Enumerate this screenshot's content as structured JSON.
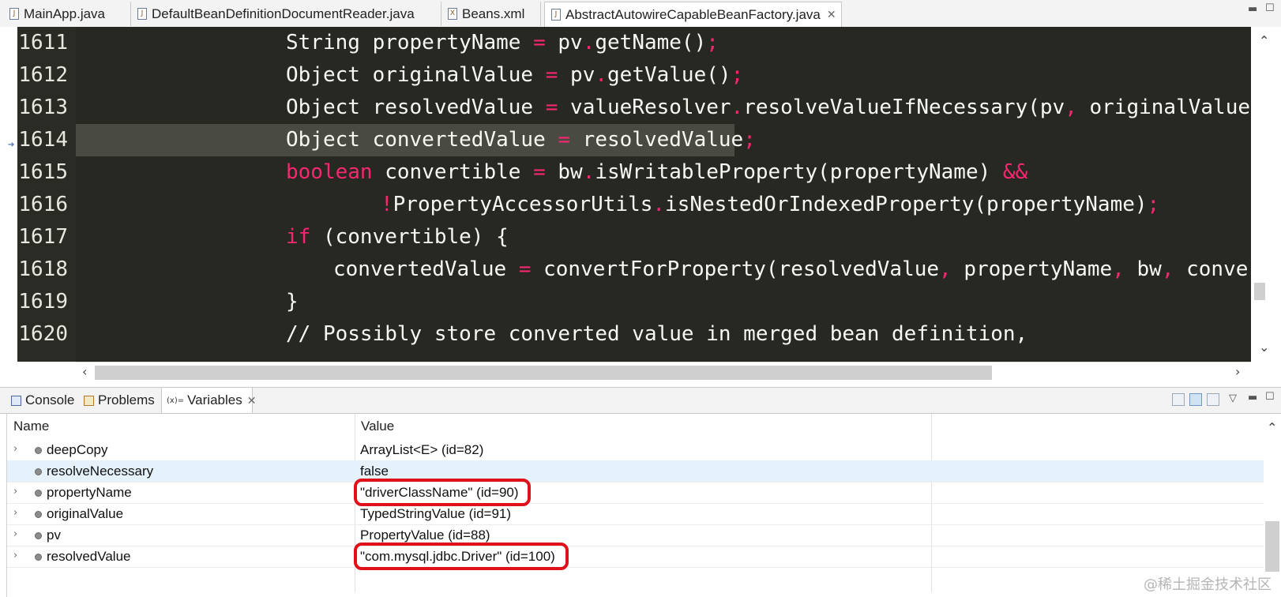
{
  "editor_tabs": [
    {
      "label": "MainApp.java",
      "icon": "java-file-icon"
    },
    {
      "label": "DefaultBeanDefinitionDocumentReader.java",
      "icon": "java-file-icon"
    },
    {
      "label": "Beans.xml",
      "icon": "xml-file-icon"
    },
    {
      "label": "AbstractAutowireCapableBeanFactory.java",
      "icon": "java-file-icon",
      "active": true
    }
  ],
  "code": {
    "current_line": "1614",
    "lines": [
      {
        "num": "1611",
        "segments": [
          {
            "t": "String propertyName ",
            "c": "pl"
          },
          {
            "t": "=",
            "c": "op"
          },
          {
            "t": " pv",
            "c": "pl"
          },
          {
            "t": ".",
            "c": "op"
          },
          {
            "t": "getName()",
            "c": "pl"
          },
          {
            "t": ";",
            "c": "op"
          }
        ]
      },
      {
        "num": "1612",
        "segments": [
          {
            "t": "Object originalValue ",
            "c": "pl"
          },
          {
            "t": "=",
            "c": "op"
          },
          {
            "t": " pv",
            "c": "pl"
          },
          {
            "t": ".",
            "c": "op"
          },
          {
            "t": "getValue()",
            "c": "pl"
          },
          {
            "t": ";",
            "c": "op"
          }
        ]
      },
      {
        "num": "1613",
        "segments": [
          {
            "t": "Object resolvedValue ",
            "c": "pl"
          },
          {
            "t": "=",
            "c": "op"
          },
          {
            "t": " valueResolver",
            "c": "pl"
          },
          {
            "t": ".",
            "c": "op"
          },
          {
            "t": "resolveValueIfNecessary(pv",
            "c": "pl"
          },
          {
            "t": ",",
            "c": "op"
          },
          {
            "t": " originalValue",
            "c": "pl"
          }
        ]
      },
      {
        "num": "1614",
        "segments": [
          {
            "t": "Object convertedValue ",
            "c": "pl"
          },
          {
            "t": "=",
            "c": "op"
          },
          {
            "t": " resolvedValue",
            "c": "pl"
          },
          {
            "t": ";",
            "c": "op"
          }
        ]
      },
      {
        "num": "1615",
        "segments": [
          {
            "t": "boolean",
            "c": "kw"
          },
          {
            "t": " convertible ",
            "c": "pl"
          },
          {
            "t": "=",
            "c": "op"
          },
          {
            "t": " bw",
            "c": "pl"
          },
          {
            "t": ".",
            "c": "op"
          },
          {
            "t": "isWritableProperty(propertyName) ",
            "c": "pl"
          },
          {
            "t": "&&",
            "c": "op"
          }
        ]
      },
      {
        "num": "1616",
        "segments": [
          {
            "t": "!",
            "c": "op"
          },
          {
            "t": "PropertyAccessorUtils",
            "c": "pl"
          },
          {
            "t": ".",
            "c": "op"
          },
          {
            "t": "isNestedOrIndexedProperty(propertyName)",
            "c": "pl"
          },
          {
            "t": ";",
            "c": "op"
          }
        ]
      },
      {
        "num": "1617",
        "segments": [
          {
            "t": "if",
            "c": "kw"
          },
          {
            "t": " (convertible) {",
            "c": "pl"
          }
        ]
      },
      {
        "num": "1618",
        "segments": [
          {
            "t": "convertedValue ",
            "c": "pl"
          },
          {
            "t": "=",
            "c": "op"
          },
          {
            "t": " convertForProperty(resolvedValue",
            "c": "pl"
          },
          {
            "t": ",",
            "c": "op"
          },
          {
            "t": " propertyName",
            "c": "pl"
          },
          {
            "t": ",",
            "c": "op"
          },
          {
            "t": " bw",
            "c": "pl"
          },
          {
            "t": ",",
            "c": "op"
          },
          {
            "t": " conve",
            "c": "pl"
          }
        ]
      },
      {
        "num": "1619",
        "segments": [
          {
            "t": "}",
            "c": "pl"
          }
        ]
      },
      {
        "num": "1620",
        "segments": [
          {
            "t": "// Possibly store converted value in merged bean definition,",
            "c": "cm"
          }
        ]
      }
    ]
  },
  "view_tabs": [
    {
      "label": "Console",
      "icon": "console-icon"
    },
    {
      "label": "Problems",
      "icon": "problems-icon"
    },
    {
      "label": "Variables",
      "icon": "variables-icon",
      "prefix": "(x)=",
      "active": true
    }
  ],
  "variables": {
    "columns": [
      "Name",
      "Value"
    ],
    "rows": [
      {
        "name": "deepCopy",
        "value": "ArrayList<E>  (id=82)",
        "expandable": true,
        "icon": "local-variable-icon"
      },
      {
        "name": "resolveNecessary",
        "value": "false",
        "expandable": false,
        "icon": "local-variable-icon",
        "selected": true
      },
      {
        "name": "propertyName",
        "value": "\"driverClassName\" (id=90)",
        "expandable": true,
        "icon": "local-variable-icon",
        "highlighted": true
      },
      {
        "name": "originalValue",
        "value": "TypedStringValue  (id=91)",
        "expandable": true,
        "icon": "local-variable-icon"
      },
      {
        "name": "pv",
        "value": "PropertyValue  (id=88)",
        "expandable": true,
        "icon": "local-variable-icon"
      },
      {
        "name": "resolvedValue",
        "value": "\"com.mysql.jdbc.Driver\" (id=100)",
        "expandable": true,
        "icon": "local-variable-icon",
        "highlighted": true
      }
    ]
  },
  "watermark": "@稀土掘金技术社区",
  "colors": {
    "editor_bg": "#272822",
    "current_line": "#494a42",
    "keyword": "#f92672",
    "text": "#f8f8f2",
    "highlight_box": "#e0111b",
    "selected_row": "#e5f1fb"
  }
}
